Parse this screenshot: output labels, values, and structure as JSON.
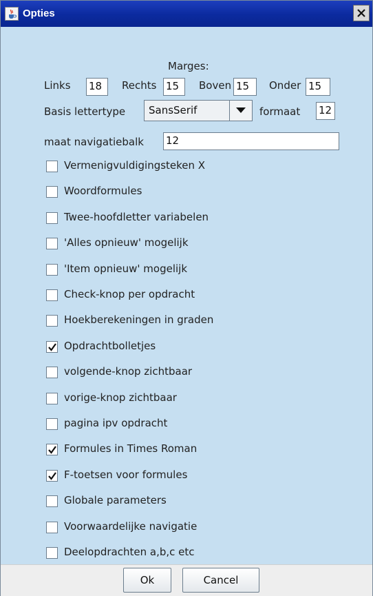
{
  "window": {
    "title": "Opties",
    "icon": "java-cup-icon",
    "close_icon": "close-icon"
  },
  "margins": {
    "heading": "Marges:",
    "links_label": "Links",
    "links_value": "18",
    "rechts_label": "Rechts",
    "rechts_value": "15",
    "boven_label": "Boven",
    "boven_value": "15",
    "onder_label": "Onder",
    "onder_value": "15"
  },
  "font": {
    "label": "Basis lettertype",
    "selected": "SansSerif",
    "size_label": "formaat",
    "size_value": "12"
  },
  "navbar": {
    "label": "maat navigatiebalk",
    "value": "12"
  },
  "options": [
    {
      "label": "Vermenigvuldigingsteken X",
      "checked": false
    },
    {
      "label": "Woordformules",
      "checked": false
    },
    {
      "label": "Twee-hoofdletter variabelen",
      "checked": false
    },
    {
      "label": "'Alles opnieuw' mogelijk",
      "checked": false
    },
    {
      "label": "'Item opnieuw' mogelijk",
      "checked": false
    },
    {
      "label": "Check-knop per opdracht",
      "checked": false
    },
    {
      "label": "Hoekberekeningen in graden",
      "checked": false
    },
    {
      "label": "Opdrachtbolletjes",
      "checked": true
    },
    {
      "label": "volgende-knop zichtbaar",
      "checked": false
    },
    {
      "label": "vorige-knop zichtbaar",
      "checked": false
    },
    {
      "label": "pagina ipv opdracht",
      "checked": false
    },
    {
      "label": "Formules in Times Roman",
      "checked": true
    },
    {
      "label": "F-toetsen voor formules",
      "checked": true
    },
    {
      "label": "Globale parameters",
      "checked": false
    },
    {
      "label": "Voorwaardelijke navigatie",
      "checked": false
    },
    {
      "label": "Deelopdrachten a,b,c etc",
      "checked": false
    }
  ],
  "buttons": {
    "ok": "Ok",
    "cancel": "Cancel"
  },
  "colors": {
    "titlebar": "#0b2a9e",
    "panel": "#c6dff1"
  }
}
